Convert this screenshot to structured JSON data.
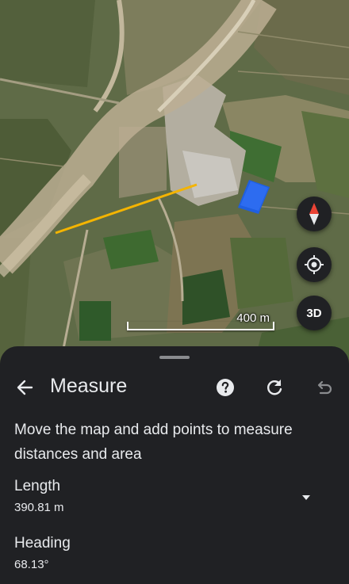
{
  "map": {
    "scale_label": "400 m",
    "button_3d_label": "3D",
    "measure_line_color": "#f4b400",
    "icons": [
      "compass-icon",
      "my-location-icon"
    ]
  },
  "measure": {
    "title": "Measure",
    "description": "Move the map and add points to measure distances and area",
    "length_label": "Length",
    "length_value": "390.81 m",
    "heading_label": "Heading",
    "heading_value": "68.13°",
    "icons": [
      "back-arrow-icon",
      "help-icon",
      "refresh-icon",
      "undo-icon",
      "chevron-down-icon"
    ]
  },
  "colors": {
    "sheet_background": "#202124",
    "text": "#e8eaed",
    "compass_red": "#ea4335"
  }
}
